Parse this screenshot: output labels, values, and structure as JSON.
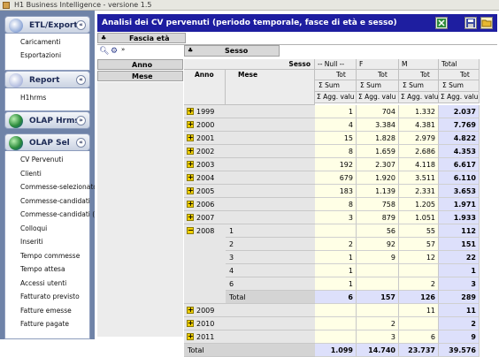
{
  "window": {
    "title": "H1 Business Intelligence - versione 1.5"
  },
  "colors": {
    "sidebar_bg": "#6f83a8",
    "title_bar": "#1e1ea0",
    "total_col": "#dde0fb",
    "data_cells": "#ffffe6",
    "expand_icon": "#f2d000"
  },
  "sidebar": {
    "panels": [
      {
        "label": "ETL/Export",
        "icon": "folder-icon",
        "chevron": "«",
        "items": [
          "Caricamenti",
          "Esportazioni"
        ]
      },
      {
        "label": "Report",
        "icon": "report-icon",
        "chevron": "«",
        "items": [
          "H1hrms"
        ]
      },
      {
        "label": "OLAP Hrms",
        "icon": "globe-icon",
        "chevron": "»",
        "items": []
      },
      {
        "label": "OLAP Sel",
        "icon": "globe-icon",
        "chevron": "«",
        "items": [
          "CV Pervenuti",
          "Clienti",
          "Commesse-selezionatori",
          "Commesse-candidati",
          "Commesse-candidati (2)",
          "Colloqui",
          "Inseriti",
          "Tempo commesse",
          "Tempo attesa",
          "Accessi utenti",
          "Fatturato previsto",
          "Fatture emesse",
          "Fatture pagate"
        ]
      }
    ]
  },
  "report": {
    "title": "Analisi dei CV pervenuti (periodo temporale, fasce di età e sesso)",
    "filter_fields": [
      "Fascia età"
    ],
    "column_fields": [
      "Sesso"
    ],
    "row_fields": [
      "Anno",
      "Mese"
    ],
    "col_header_label": "Sesso",
    "col_values": [
      "-- Null --",
      "F",
      "M",
      "Total"
    ],
    "tot_label": "Tot",
    "sum_label": "Sum",
    "agg_label": "Agg. valu",
    "row_hdr_anno": "Anno",
    "row_hdr_mese": "Mese",
    "rows": [
      {
        "year": "1999",
        "month": "",
        "vals": [
          "1",
          "704",
          "1.332",
          "2.037"
        ],
        "exp": "+"
      },
      {
        "year": "2000",
        "month": "",
        "vals": [
          "4",
          "3.384",
          "4.381",
          "7.769"
        ],
        "exp": "+"
      },
      {
        "year": "2001",
        "month": "",
        "vals": [
          "15",
          "1.828",
          "2.979",
          "4.822"
        ],
        "exp": "+"
      },
      {
        "year": "2002",
        "month": "",
        "vals": [
          "8",
          "1.659",
          "2.686",
          "4.353"
        ],
        "exp": "+"
      },
      {
        "year": "2003",
        "month": "",
        "vals": [
          "192",
          "2.307",
          "4.118",
          "6.617"
        ],
        "exp": "+"
      },
      {
        "year": "2004",
        "month": "",
        "vals": [
          "679",
          "1.920",
          "3.511",
          "6.110"
        ],
        "exp": "+"
      },
      {
        "year": "2005",
        "month": "",
        "vals": [
          "183",
          "1.139",
          "2.331",
          "3.653"
        ],
        "exp": "+"
      },
      {
        "year": "2006",
        "month": "",
        "vals": [
          "8",
          "758",
          "1.205",
          "1.971"
        ],
        "exp": "+"
      },
      {
        "year": "2007",
        "month": "",
        "vals": [
          "3",
          "879",
          "1.051",
          "1.933"
        ],
        "exp": "+"
      },
      {
        "year": "2008",
        "month": "1",
        "vals": [
          "",
          "56",
          "55",
          "112"
        ],
        "exp": "−"
      },
      {
        "year": "",
        "month": "2",
        "vals": [
          "2",
          "92",
          "57",
          "151"
        ],
        "exp": ""
      },
      {
        "year": "",
        "month": "3",
        "vals": [
          "1",
          "9",
          "12",
          "22"
        ],
        "exp": ""
      },
      {
        "year": "",
        "month": "4",
        "vals": [
          "1",
          "",
          "",
          "1"
        ],
        "exp": ""
      },
      {
        "year": "",
        "month": "6",
        "vals": [
          "1",
          "",
          "2",
          "3"
        ],
        "exp": ""
      },
      {
        "year": "",
        "month": "Total",
        "vals": [
          "6",
          "157",
          "126",
          "289"
        ],
        "exp": "",
        "subtotal": true
      },
      {
        "year": "2009",
        "month": "",
        "vals": [
          "",
          "",
          "11",
          "11"
        ],
        "exp": "+"
      },
      {
        "year": "2010",
        "month": "",
        "vals": [
          "",
          "2",
          "",
          "2"
        ],
        "exp": "+"
      },
      {
        "year": "2011",
        "month": "",
        "vals": [
          "",
          "3",
          "6",
          "9"
        ],
        "exp": "+"
      },
      {
        "year": "Total",
        "month": "",
        "vals": [
          "1.099",
          "14.740",
          "23.737",
          "39.576"
        ],
        "exp": "",
        "grandtotal": true
      }
    ]
  }
}
